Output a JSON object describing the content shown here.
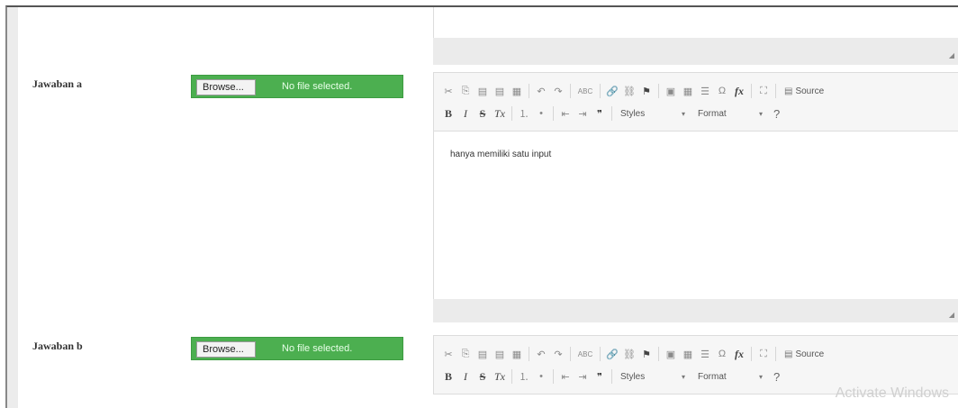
{
  "top_editor": {
    "resize_glyph": "◢"
  },
  "answers": [
    {
      "label": "Jawaban a",
      "file": {
        "browse_label": "Browse...",
        "status": "No file selected."
      },
      "editor": {
        "content": "hanya memiliki satu input",
        "source_label": "Source",
        "styles_label": "Styles",
        "format_label": "Format",
        "help_label": "?"
      }
    },
    {
      "label": "Jawaban b",
      "file": {
        "browse_label": "Browse...",
        "status": "No file selected."
      },
      "editor": {
        "source_label": "Source",
        "styles_label": "Styles",
        "format_label": "Format",
        "help_label": "?"
      }
    }
  ],
  "toolbar_icons": {
    "cut": "✂",
    "copy": "⎘",
    "paste": "📋",
    "paste_text": "▤",
    "paste_word": "▦",
    "undo": "↶",
    "redo": "↷",
    "spell": "ABC",
    "link": "🔗",
    "unlink": "⛓",
    "anchor": "⚑",
    "image": "▣",
    "table": "▦",
    "hr": "☰",
    "special_char": "Ω",
    "formula": "fx",
    "maximize": "⛶",
    "source_icon": "▤",
    "bold": "B",
    "italic": "I",
    "strike": "S",
    "remove_format": "Tx",
    "numbered_list": "⒈",
    "bulleted_list": "•",
    "outdent": "⇤",
    "indent": "⇥",
    "blockquote": "❞",
    "dropdown_arrow": "▾"
  },
  "watermark": "Activate Windows"
}
